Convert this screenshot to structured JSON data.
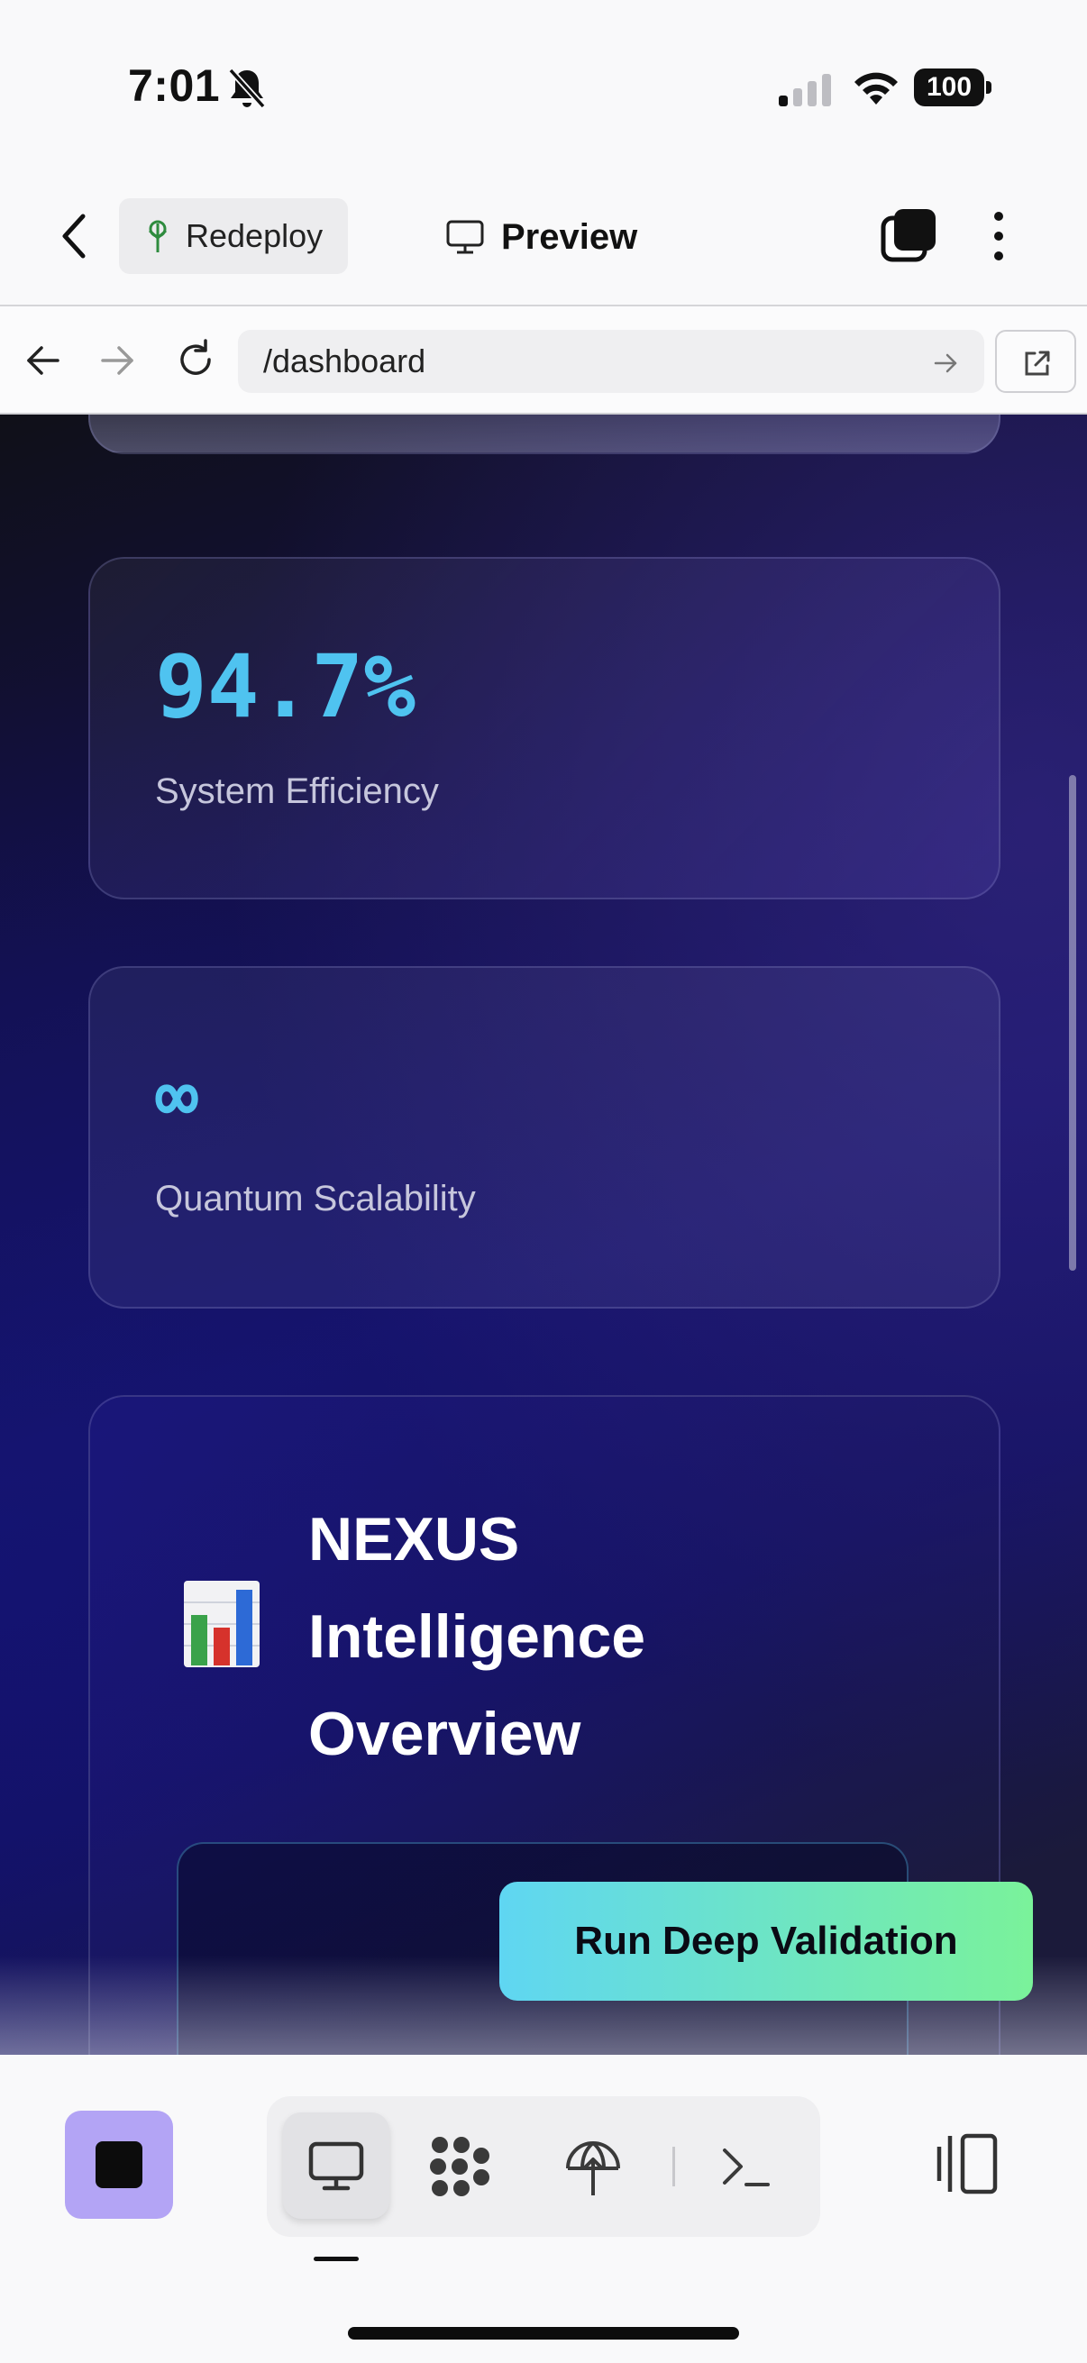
{
  "status_bar": {
    "time": "7:01",
    "battery": "100"
  },
  "header": {
    "redeploy_label": "Redeploy",
    "preview_label": "Preview"
  },
  "url_bar": {
    "url": "/dashboard"
  },
  "content": {
    "metrics": [
      {
        "value": "94.7%",
        "label": "System Efficiency"
      },
      {
        "value": "∞",
        "label": "Quantum Scalability"
      }
    ],
    "nexus_icon": "bar-chart-emoji",
    "nexus_title": "NEXUS Intelligence Overview",
    "cta_label": "Run Deep Validation"
  },
  "colors": {
    "accent_cyan": "#4fc3f0",
    "cta_start": "#5fd6f2",
    "cta_end": "#7af29a",
    "stop_button": "#b3a4f5"
  }
}
